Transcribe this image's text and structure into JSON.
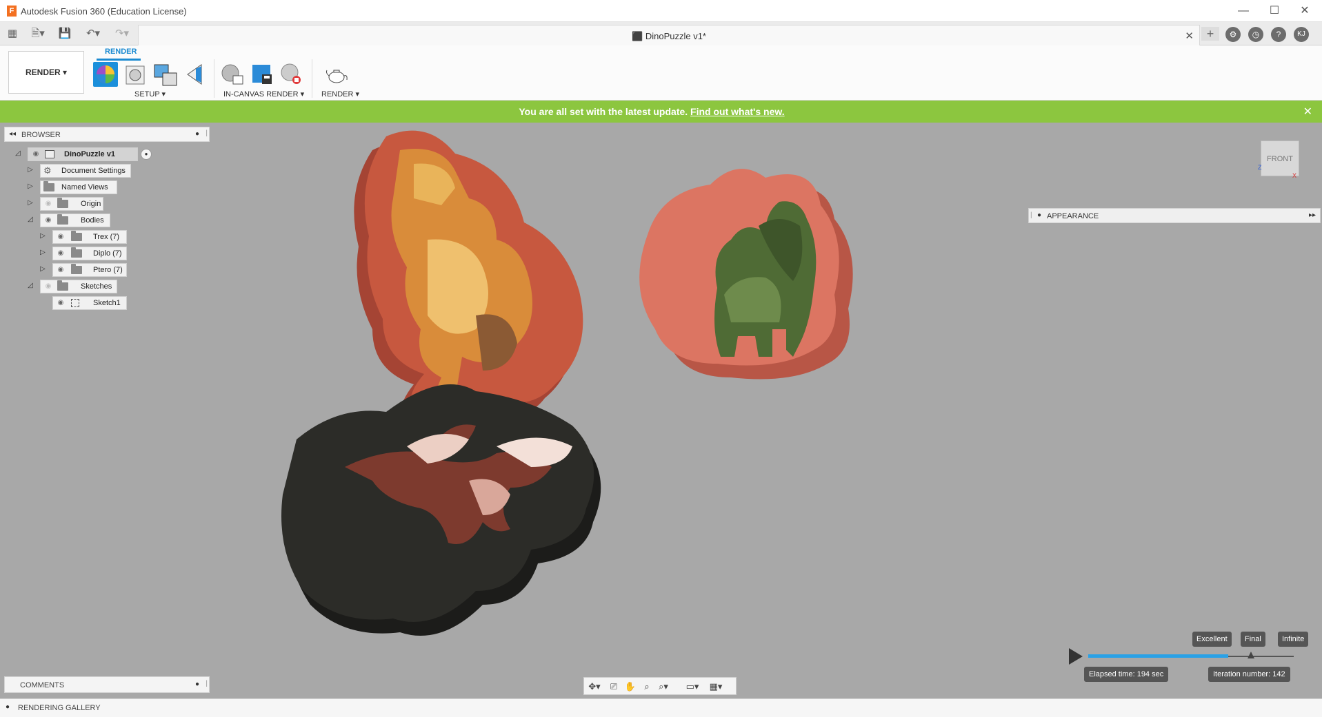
{
  "window": {
    "title": "Autodesk Fusion 360 (Education License)",
    "minimize": "—",
    "maximize": "☐",
    "close": "✕"
  },
  "tabs": {
    "document_title": "DinoPuzzle v1*",
    "user_initials": "KJ"
  },
  "toolbar": {
    "workspace": "RENDER ▾",
    "active_tab": "RENDER",
    "groups": [
      {
        "label": "SETUP ▾"
      },
      {
        "label": "IN-CANVAS RENDER ▾"
      },
      {
        "label": "RENDER ▾"
      }
    ]
  },
  "notification": {
    "text": "You are all set with the latest update.",
    "link": "Find out what's new.",
    "close": "✕"
  },
  "browser": {
    "title": "BROWSER",
    "root": "DinoPuzzle v1",
    "items": [
      {
        "label": "Document Settings"
      },
      {
        "label": "Named Views"
      },
      {
        "label": "Origin"
      },
      {
        "label": "Bodies"
      },
      {
        "label": "Trex (7)"
      },
      {
        "label": "Diplo (7)"
      },
      {
        "label": "Ptero (7)"
      },
      {
        "label": "Sketches"
      },
      {
        "label": "Sketch1"
      }
    ]
  },
  "appearance": {
    "title": "APPEARANCE"
  },
  "viewcube": {
    "face": "FRONT"
  },
  "render_quality": {
    "levels": [
      "Excellent",
      "Final",
      "Infinite"
    ],
    "progress": 0.68,
    "elapsed": "Elapsed time: 194 sec",
    "iteration": "Iteration number: 142"
  },
  "comments": {
    "title": "COMMENTS"
  },
  "gallery": {
    "title": "RENDERING GALLERY"
  },
  "colors": {
    "accent": "#1a8ad1",
    "notify": "#8cc63f",
    "trex_frame": "#c7583f",
    "trex_piece": "#e0a34a",
    "diplo_frame": "#dc7562",
    "diplo_piece": "#4f6b35",
    "ptero_frame": "#2c2c28",
    "ptero_piece": "#eccfc4"
  }
}
